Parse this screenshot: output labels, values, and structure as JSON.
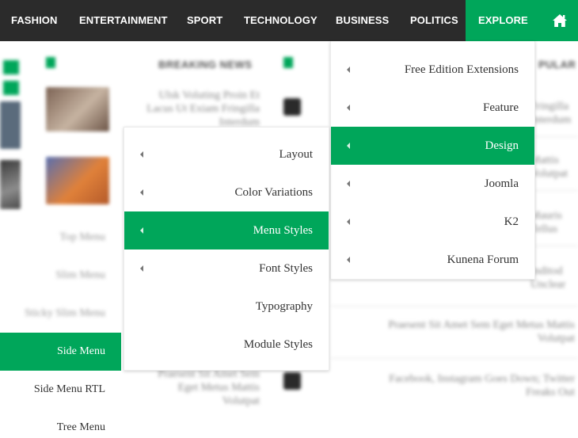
{
  "topnav": {
    "items": [
      {
        "label": "FASHION"
      },
      {
        "label": "ENTERTAINMENT"
      },
      {
        "label": "SPORT"
      },
      {
        "label": "TECHNOLOGY"
      },
      {
        "label": "BUSINESS"
      },
      {
        "label": "POLITICS"
      },
      {
        "label": "EXPLORE"
      }
    ],
    "home_icon": "home-icon"
  },
  "background": {
    "breaking_news_heading": "BREAKING NEWS",
    "popular_heading": "PULAR",
    "news_1": [
      "Ulsk Voluting Proin Et",
      "Lacus Ut Exiam Fringilla",
      "Interdum"
    ],
    "news_2": [
      "Praesent Sit Amet Sem",
      "Eget Metus Mattis",
      "Volutpat"
    ],
    "right_1": [
      "Fringilla",
      "Interdum"
    ],
    "right_2": [
      "Mattis",
      "Volutpat"
    ],
    "right_3": [
      "Mauris",
      "Tellus"
    ],
    "right_4": [
      "Inditod",
      "Unclear"
    ],
    "right_5": [
      "Praesent Sit Amet Sem Eget Metus Mattis",
      "Volutpat"
    ],
    "right_6": [
      "Facebook, Instagram Goes Down; Twitter",
      "Freaks Out"
    ]
  },
  "sidemenu": {
    "items": [
      {
        "label": "Top Menu",
        "state": "blur"
      },
      {
        "label": "Slim Menu",
        "state": "blur"
      },
      {
        "label": "Sticky Slim Menu",
        "state": "blur"
      },
      {
        "label": "Side Menu",
        "state": "active"
      },
      {
        "label": "Side Menu RTL",
        "state": "normal"
      },
      {
        "label": "Tree Menu",
        "state": "normal"
      }
    ]
  },
  "explore_menu": {
    "items": [
      {
        "label": "Free Edition Extensions",
        "active": false
      },
      {
        "label": "Feature",
        "active": false
      },
      {
        "label": "Design",
        "active": true
      },
      {
        "label": "Joomla",
        "active": false
      },
      {
        "label": "K2",
        "active": false
      },
      {
        "label": "Kunena Forum",
        "active": false
      }
    ]
  },
  "design_menu": {
    "items": [
      {
        "label": "Layout",
        "caret": true,
        "active": false
      },
      {
        "label": "Color Variations",
        "caret": true,
        "active": false
      },
      {
        "label": "Menu Styles",
        "caret": true,
        "active": true
      },
      {
        "label": "Font Styles",
        "caret": true,
        "active": false
      },
      {
        "label": "Typography",
        "caret": false,
        "active": false
      },
      {
        "label": "Module Styles",
        "caret": false,
        "active": false
      }
    ]
  },
  "colors": {
    "accent": "#00a65a",
    "nav_bg": "#2b2b2b"
  }
}
